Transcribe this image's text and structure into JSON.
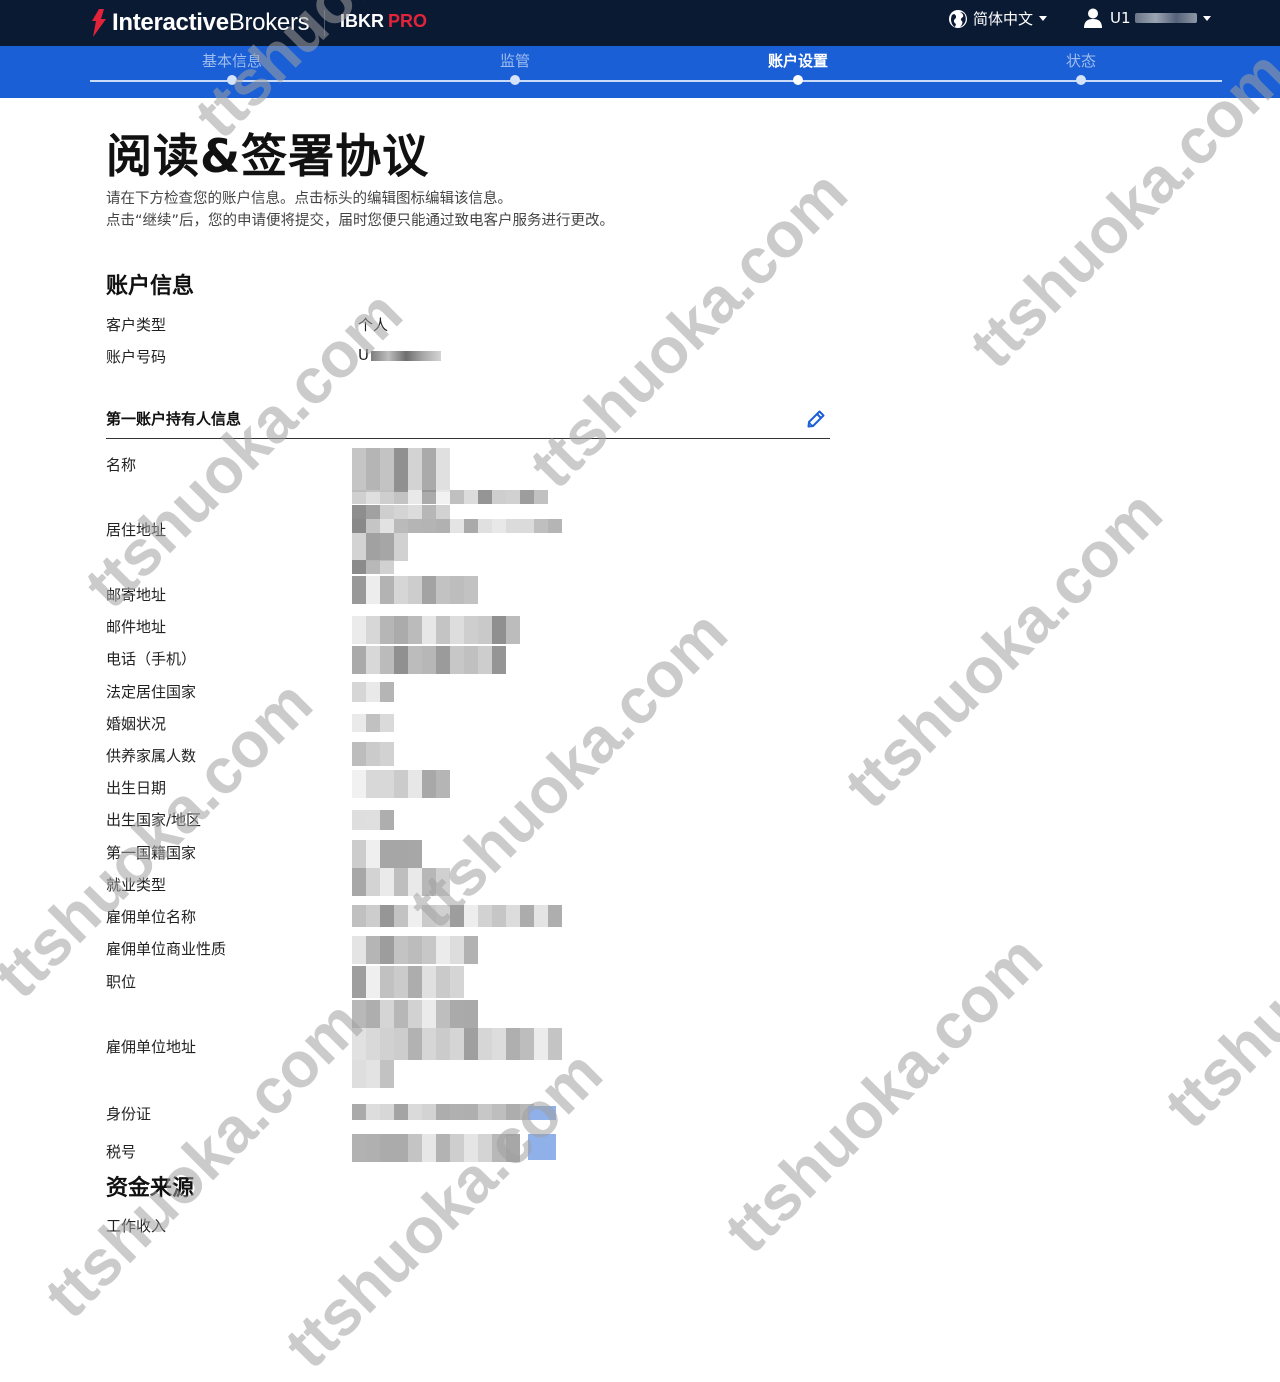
{
  "header": {
    "brand_bold": "Interactive",
    "brand_light": "Brokers",
    "product": "IBKR",
    "product_tier": "PRO",
    "language": "简体中文",
    "user": "U1"
  },
  "steps": [
    {
      "label": "基本信息",
      "active": false
    },
    {
      "label": "监管",
      "active": false
    },
    {
      "label": "账户设置",
      "active": true
    },
    {
      "label": "状态",
      "active": false
    }
  ],
  "page": {
    "title": "阅读&签署协议",
    "intro_line1": "请在下方检查您的账户信息。点击标头的编辑图标编辑该信息。",
    "intro_line2": "点击“继续”后，您的申请便将提交，届时您便只能通过致电客户服务进行更改。"
  },
  "account_info": {
    "title": "账户信息",
    "rows": [
      {
        "label": "客户类型",
        "value": "个人"
      },
      {
        "label": "账户号码",
        "value": "U"
      }
    ]
  },
  "holder_info": {
    "title": "第一账户持有人信息",
    "fields": [
      "名称",
      "居住地址",
      "邮寄地址",
      "邮件地址",
      "电话（手机）",
      "法定居住国家",
      "婚姻状况",
      "供养家属人数",
      "出生日期",
      "出生国家/地区",
      "第一国籍国家",
      "就业类型",
      "雇佣单位名称",
      "雇佣单位商业性质",
      "职位",
      "雇佣单位地址",
      "身份证",
      "税号"
    ]
  },
  "funds_source": {
    "title": "资金来源",
    "items": [
      "工作收入"
    ]
  },
  "colors": {
    "navbar": "#0b1a33",
    "steps_bar": "#1a5fd6",
    "brand_red": "#e2243b",
    "edit_icon": "#1a5fd6"
  },
  "icons": {
    "language": "globe-icon",
    "user": "user-icon",
    "edit": "pencil-icon"
  },
  "watermark": "ttshuoka.com"
}
